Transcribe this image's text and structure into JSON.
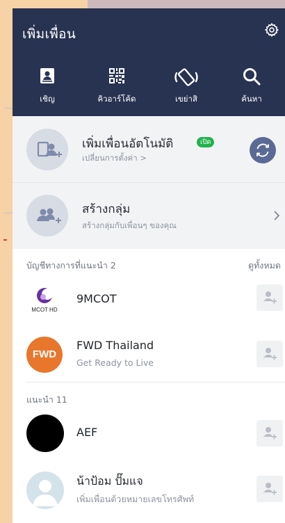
{
  "header": {
    "title": "เพิ่มเพื่อน",
    "tools": [
      {
        "label": "เชิญ",
        "icon": "invite-icon"
      },
      {
        "label": "คิวอาร์โค้ด",
        "icon": "qr-code-icon"
      },
      {
        "label": "เขย่าสิ",
        "icon": "shake-icon"
      },
      {
        "label": "ค้นหา",
        "icon": "search-icon"
      }
    ]
  },
  "auto_add": {
    "title": "เพิ่มเพื่อนอัตโนมัติ",
    "badge": "เปิด",
    "subtitle": "เปลี่ยนการตั้งค่า >"
  },
  "create_group": {
    "title": "สร้างกลุ่ม",
    "subtitle": "สร้างกลุ่มกับเพื่อนๆ ของคุณ"
  },
  "official_section": {
    "label": "บัญชีทางการที่แนะนำ 2",
    "see_all": "ดูทั้งหมด"
  },
  "official_accounts": [
    {
      "name": "9MCOT",
      "subtitle": "",
      "logo_text": "MCOT HD"
    },
    {
      "name": "FWD Thailand",
      "subtitle": "Get Ready to Live",
      "logo_text": "FWD"
    }
  ],
  "recommend_section": {
    "label": "แนะนำ 11"
  },
  "recommended": [
    {
      "name": "AEF",
      "subtitle": ""
    },
    {
      "name": "น้าป้อม ปั๊มแจ",
      "subtitle": "เพิ่มเพื่อนด้วยหมายเลขโทรศัพท์"
    }
  ],
  "colors": {
    "header_bg": "#283352",
    "badge_green": "#22b24c",
    "fwd_orange": "#e8762d",
    "mcot_purple": "#6b2fa0"
  }
}
